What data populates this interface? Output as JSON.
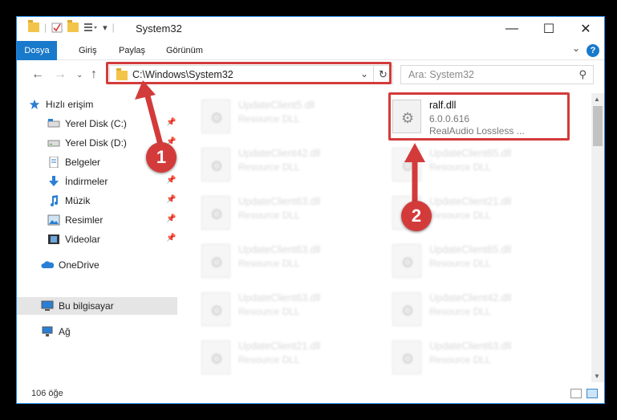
{
  "window": {
    "title": "System32",
    "controls": {
      "minimize": "—",
      "maximize": "☐",
      "close": "✕"
    }
  },
  "ribbon": {
    "tabs": [
      "Dosya",
      "Giriş",
      "Paylaş",
      "Görünüm"
    ],
    "help": "?"
  },
  "address": {
    "path": "C:\\Windows\\System32",
    "search_placeholder": "Ara: System32"
  },
  "sidebar": {
    "quick_access": "Hızlı erişim",
    "items": [
      {
        "label": "Yerel Disk (C:)",
        "icon": "drive-icon",
        "pinned": true
      },
      {
        "label": "Yerel Disk (D:)",
        "icon": "drive-icon",
        "pinned": true
      },
      {
        "label": "Belgeler",
        "icon": "documents-icon",
        "pinned": true
      },
      {
        "label": "İndirmeler",
        "icon": "download-icon",
        "pinned": true
      },
      {
        "label": "Müzik",
        "icon": "music-icon",
        "pinned": true
      },
      {
        "label": "Resimler",
        "icon": "pictures-icon",
        "pinned": true
      },
      {
        "label": "Videolar",
        "icon": "videos-icon",
        "pinned": true
      }
    ],
    "onedrive": "OneDrive",
    "this_pc": "Bu bilgisayar",
    "network": "Ağ"
  },
  "files": {
    "left_column": [
      {
        "name": "UpdateClient5.dll",
        "type": "Resource DLL"
      },
      {
        "name": "UpdateClient42.dll",
        "type": "Resource DLL"
      },
      {
        "name": "UpdateClient63.dll",
        "type": "Resource DLL"
      },
      {
        "name": "UpdateClient63.dll",
        "type": "Resource DLL"
      },
      {
        "name": "UpdateClient63.dll",
        "type": "Resource DLL"
      },
      {
        "name": "UpdateClient21.dll",
        "type": "Resource DLL"
      }
    ],
    "highlighted": {
      "name": "ralf.dll",
      "version": "6.0.0.616",
      "description": "RealAudio Lossless ..."
    },
    "right_column": [
      {
        "name": "UpdateClient65.dll",
        "type": "Resource DLL"
      },
      {
        "name": "UpdateClient21.dll",
        "type": "Resource DLL"
      },
      {
        "name": "UpdateClient65.dll",
        "type": "Resource DLL"
      },
      {
        "name": "UpdateClient42.dll",
        "type": "Resource DLL"
      },
      {
        "name": "UpdateClient63.dll",
        "type": "Resource DLL"
      }
    ]
  },
  "status": {
    "count": "106 öğe"
  },
  "annotations": {
    "step1": "1",
    "step2": "2",
    "color": "#d33b3b"
  }
}
